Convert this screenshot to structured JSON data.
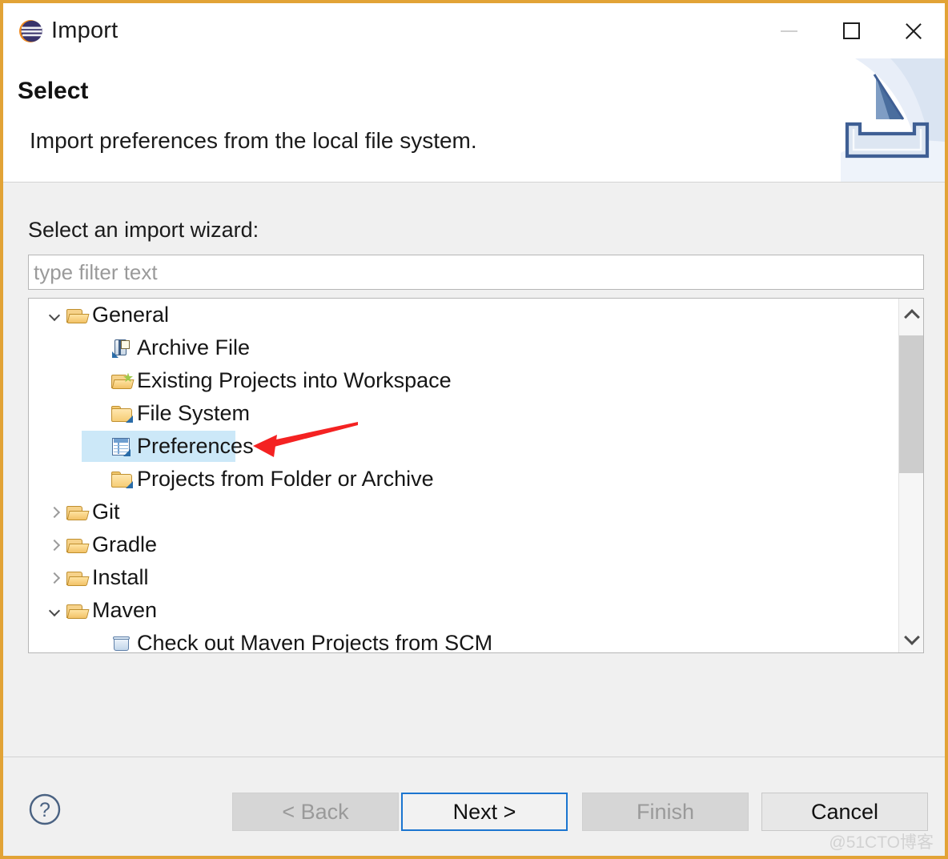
{
  "window": {
    "title": "Import",
    "icon": "eclipse-logo-icon",
    "border_color": "#e2a336",
    "controls": {
      "minimize": "minimize-icon",
      "maximize": "maximize-icon",
      "close": "close-icon"
    }
  },
  "header": {
    "title": "Select",
    "description": "Import preferences from the local file system.",
    "banner_icon": "import-tray-arrow-icon"
  },
  "form": {
    "label": "Select an import wizard:",
    "filter": {
      "value": "",
      "placeholder": "type filter text"
    }
  },
  "tree": {
    "selected": "Preferences",
    "selection_color": "#cce8f8",
    "items": [
      {
        "label": "General",
        "icon": "folder-open-icon",
        "level": 0,
        "expander": "chevron-down",
        "selected": false
      },
      {
        "label": "Archive File",
        "icon": "archive-file-icon",
        "level": 1,
        "expander": "none",
        "selected": false
      },
      {
        "label": "Existing Projects into Workspace",
        "icon": "folder-open-star-icon",
        "level": 1,
        "expander": "none",
        "selected": false
      },
      {
        "label": "File System",
        "icon": "folder-closed-icon",
        "level": 1,
        "expander": "none",
        "selected": false
      },
      {
        "label": "Preferences",
        "icon": "preferences-table-icon",
        "level": 1,
        "expander": "none",
        "selected": true
      },
      {
        "label": "Projects from Folder or Archive",
        "icon": "folder-closed-icon",
        "level": 1,
        "expander": "none",
        "selected": false
      },
      {
        "label": "Git",
        "icon": "folder-open-icon",
        "level": 0,
        "expander": "chevron-right",
        "selected": false
      },
      {
        "label": "Gradle",
        "icon": "folder-open-icon",
        "level": 0,
        "expander": "chevron-right",
        "selected": false
      },
      {
        "label": "Install",
        "icon": "folder-open-icon",
        "level": 0,
        "expander": "chevron-right",
        "selected": false
      },
      {
        "label": "Maven",
        "icon": "folder-open-icon",
        "level": 0,
        "expander": "chevron-down",
        "selected": false
      },
      {
        "label": "Check out Maven Projects from SCM",
        "icon": "maven-checkout-icon",
        "level": 1,
        "expander": "none",
        "selected": false
      }
    ],
    "scrollbar": {
      "up_arrow": "chevron-up-icon",
      "down_arrow": "chevron-down-icon"
    }
  },
  "annotation": {
    "arrow_color": "#f42222",
    "points_at": "Preferences"
  },
  "footer": {
    "help": "?",
    "buttons": [
      {
        "label": "< Back",
        "state": "disabled"
      },
      {
        "label": "Next >",
        "state": "default"
      },
      {
        "label": "Finish",
        "state": "disabled"
      },
      {
        "label": "Cancel",
        "state": "enabled"
      }
    ]
  },
  "watermark": "@51CTO博客"
}
